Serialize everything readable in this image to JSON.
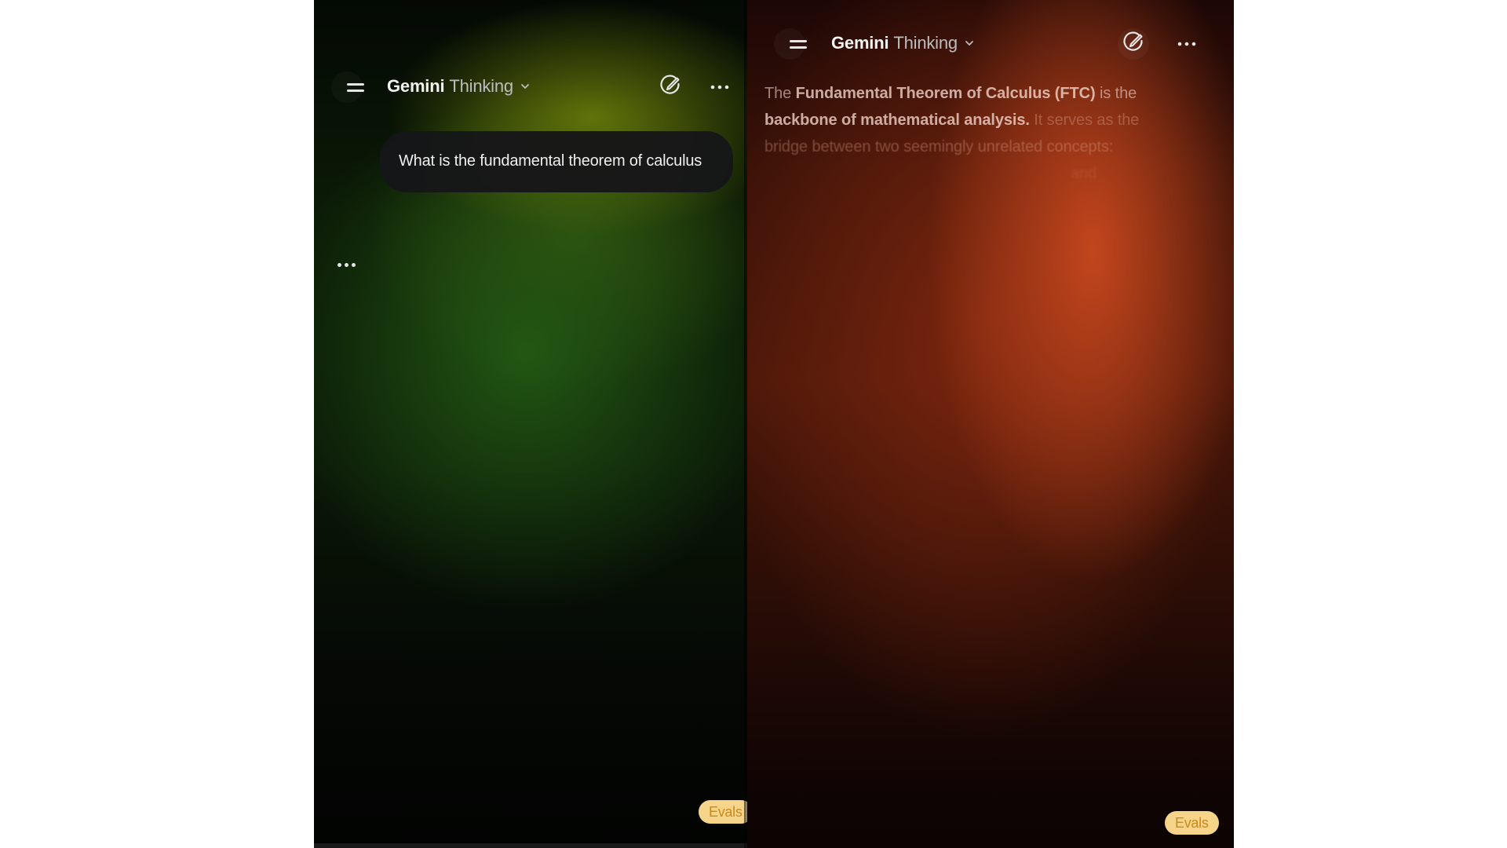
{
  "left_panel": {
    "header": {
      "brand": "Gemini",
      "mode": "Thinking",
      "menu_icon": "menu-icon",
      "chevron_icon": "chevron-down-icon",
      "edit_icon": "new-chat-pencil-icon",
      "more_icon": "more-horizontal-icon"
    },
    "user_message": "What is the fundamental theorem of calculus",
    "thinking_indicator": "loading-dots-icon",
    "badge": "Evals"
  },
  "right_panel": {
    "header": {
      "brand": "Gemini",
      "mode": "Thinking",
      "menu_icon": "menu-icon",
      "chevron_icon": "chevron-down-icon",
      "edit_icon": "new-chat-pencil-icon",
      "more_icon": "more-horizontal-icon"
    },
    "response": {
      "line1_a": "The ",
      "line1_b": "Fundamental Theorem of Calculus (FTC)",
      "line1_c": " is the",
      "line2_a": "backbone of mathematical analysis.",
      "line2_b": " It serves as the",
      "line3": "bridge between two seemingly unrelated concepts:",
      "line4": "and"
    },
    "badge": "Evals"
  },
  "colors": {
    "left_accent": "#6e800a",
    "right_accent": "#c8481e",
    "bubble": "#161618",
    "badge_bg": "#f6d58b",
    "badge_text": "#c88a1d"
  }
}
